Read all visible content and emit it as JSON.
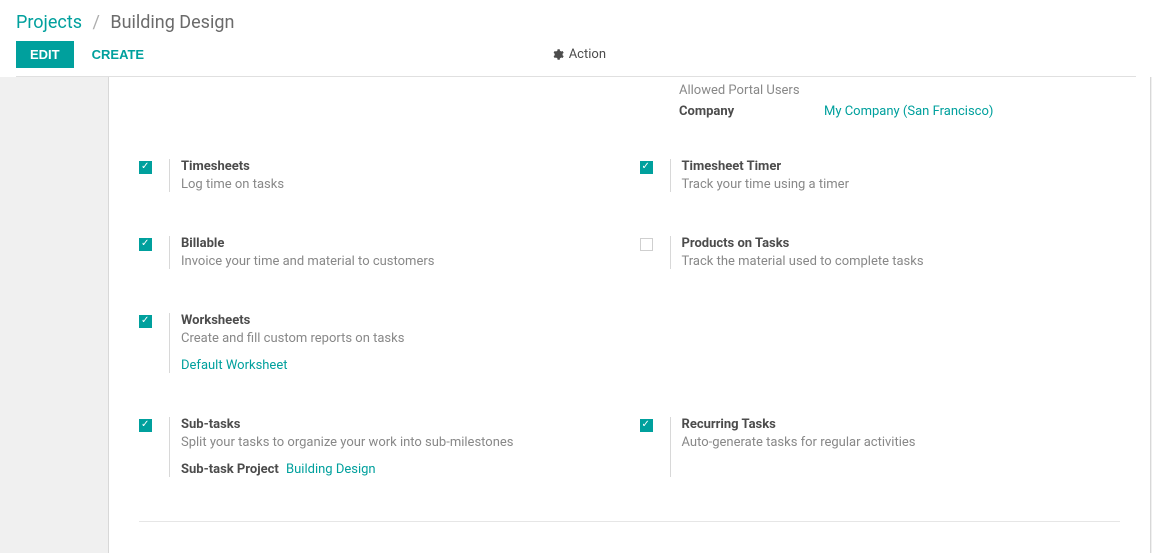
{
  "breadcrumb": {
    "root": "Projects",
    "current": "Building Design"
  },
  "toolbar": {
    "edit": "EDIT",
    "create": "CREATE",
    "action": "Action"
  },
  "top_info": {
    "allowed_label": "Allowed Portal Users",
    "company_label": "Company",
    "company_value": "My Company (San Francisco)"
  },
  "settings": {
    "timesheets": {
      "title": "Timesheets",
      "desc": "Log time on tasks"
    },
    "timer": {
      "title": "Timesheet Timer",
      "desc": "Track your time using a timer"
    },
    "billable": {
      "title": "Billable",
      "desc": "Invoice your time and material to customers"
    },
    "products": {
      "title": "Products on Tasks",
      "desc": "Track the material used to complete tasks"
    },
    "worksheets": {
      "title": "Worksheets",
      "desc": "Create and fill custom reports on tasks",
      "link": "Default Worksheet"
    },
    "subtasks": {
      "title": "Sub-tasks",
      "desc": "Split your tasks to organize your work into sub-milestones",
      "extra_label": "Sub-task Project",
      "extra_value": "Building Design"
    },
    "recurring": {
      "title": "Recurring Tasks",
      "desc": "Auto-generate tasks for regular activities"
    }
  }
}
